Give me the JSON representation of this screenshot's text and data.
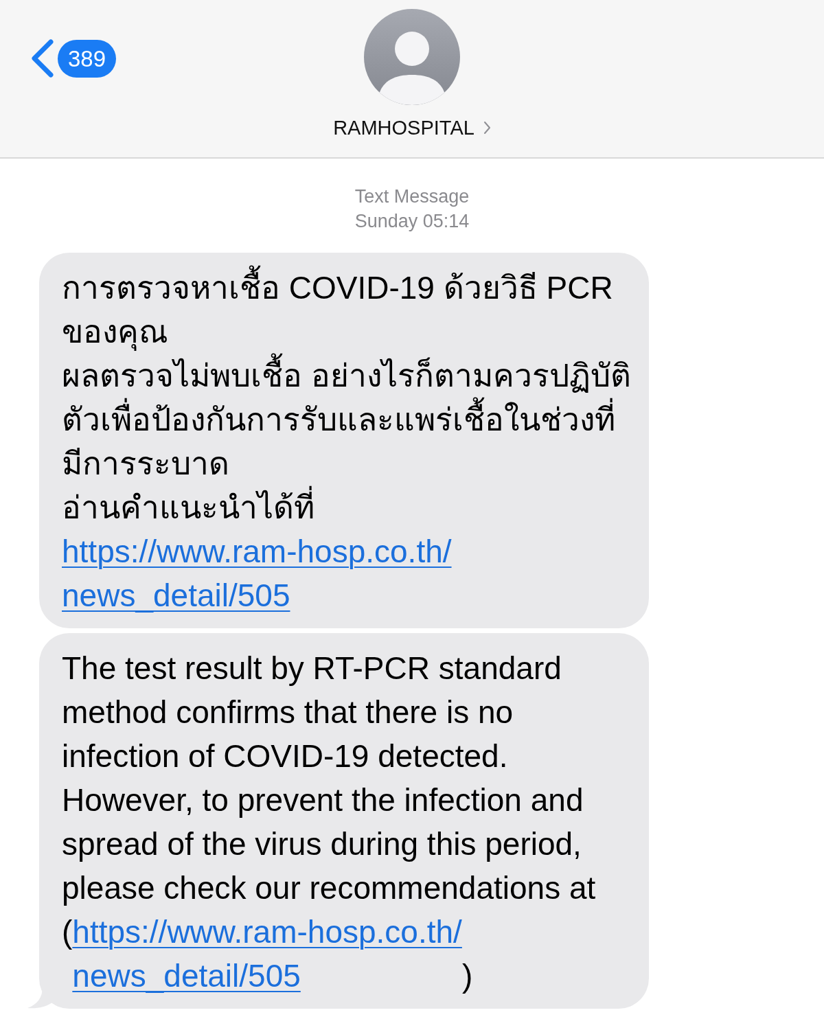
{
  "header": {
    "back_button": {
      "count": "389"
    },
    "contact": {
      "name": "RAMHOSPITAL"
    }
  },
  "timestamp": {
    "service": "Text Message",
    "time": "Sunday 05:14"
  },
  "messages": [
    {
      "tail": false,
      "segments": [
        {
          "kind": "text",
          "text": "การตรวจหาเชื้อ COVID-19 ด้วยวิธี PCR ของคุณ\nผลตรวจไม่พบเชื้อ อย่างไรก็ตามควรปฏิบัติตัวเพื่อป้องกันการรับและแพร่เชื้อในช่วงที่มีการระบาด\nอ่านคำแนะนำได้ที่\n"
        },
        {
          "kind": "link",
          "text": "https://www.ram-hosp.co.th/news_detail/505"
        }
      ]
    },
    {
      "tail": true,
      "segments": [
        {
          "kind": "text",
          "text": "The test result by RT-PCR standard method confirms that there is no infection of COVID-19 detected. However, to prevent the infection and spread of the virus during this period, please check our recommendations at ("
        },
        {
          "kind": "link",
          "text": "https://www.ram-hosp.co.th/news_detail/505"
        },
        {
          "kind": "text",
          "text": ")"
        }
      ]
    }
  ]
}
